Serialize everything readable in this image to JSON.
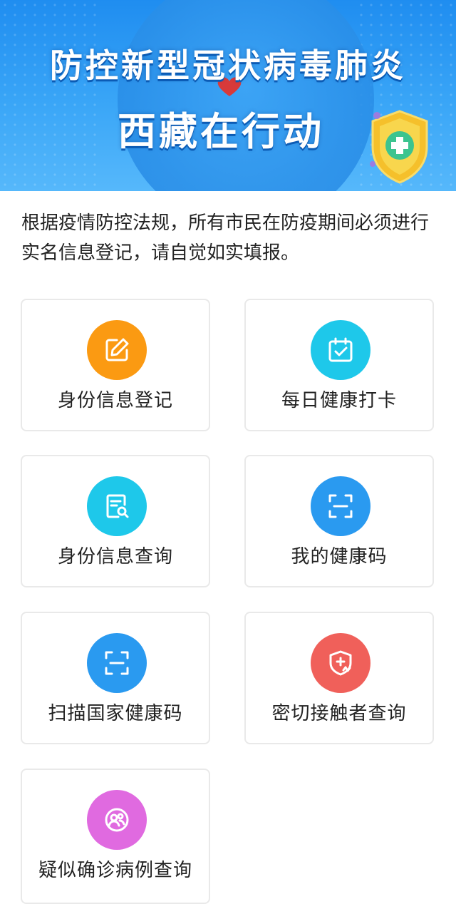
{
  "banner": {
    "title_line1": "防控新型冠状病毒肺炎",
    "title_line2": "西藏在行动",
    "colors": {
      "background": "#2a92ec",
      "shield": "#f5c02b",
      "cross": "#3cc48f"
    }
  },
  "notice": {
    "text": "根据疫情防控法规，所有市民在防疫期间必须进行实名信息登记，请自觉如实填报。"
  },
  "cards": [
    {
      "label": "身份信息登记",
      "icon": "edit-icon",
      "color": "#fb9a12"
    },
    {
      "label": "每日健康打卡",
      "icon": "calendar-check-icon",
      "color": "#1ec8ea"
    },
    {
      "label": "身份信息查询",
      "icon": "document-search-icon",
      "color": "#1ec8ea"
    },
    {
      "label": "我的健康码",
      "icon": "scan-icon",
      "color": "#2a9af0"
    },
    {
      "label": "扫描国家健康码",
      "icon": "scan-icon",
      "color": "#2a9af0"
    },
    {
      "label": "密切接触者查询",
      "icon": "shield-plus-icon",
      "color": "#f0605a"
    },
    {
      "label": "疑似确诊病例查询",
      "icon": "people-icon",
      "color": "#e06ae0"
    }
  ]
}
